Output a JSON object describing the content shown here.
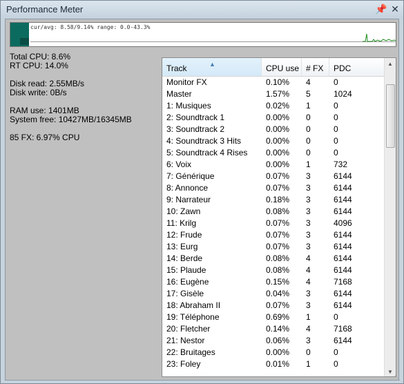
{
  "window": {
    "title": "Performance Meter"
  },
  "meter": {
    "readout": "cur/avg: 8.58/9.14%  range: 0.0-43.3%"
  },
  "stats": {
    "total_cpu": "Total CPU: 8.6%",
    "rt_cpu": "RT CPU: 14.0%",
    "disk_read": "Disk read: 2.55MB/s",
    "disk_write": "Disk write: 0B/s",
    "ram_use": "RAM use: 1401MB",
    "system_free": "System free: 10427MB/16345MB",
    "fx_summary": "85 FX: 6.97% CPU"
  },
  "table": {
    "headers": [
      "Track",
      "CPU use",
      "# FX",
      "PDC"
    ],
    "rows": [
      [
        "Monitor FX",
        "0.10%",
        "4",
        "0"
      ],
      [
        "Master",
        "1.57%",
        "5",
        "1024"
      ],
      [
        "1: Musiques",
        "0.02%",
        "1",
        "0"
      ],
      [
        "2: Soundtrack 1",
        "0.00%",
        "0",
        "0"
      ],
      [
        "3: Soundtrack 2",
        "0.00%",
        "0",
        "0"
      ],
      [
        "4: Soundtrack 3 Hits",
        "0.00%",
        "0",
        "0"
      ],
      [
        "5: Soundtrack 4 Rises",
        "0.00%",
        "0",
        "0"
      ],
      [
        "6: Voix",
        "0.00%",
        "1",
        "732"
      ],
      [
        "7: Générique",
        "0.07%",
        "3",
        "6144"
      ],
      [
        "8: Annonce",
        "0.07%",
        "3",
        "6144"
      ],
      [
        "9: Narrateur",
        "0.18%",
        "3",
        "6144"
      ],
      [
        "10: Zawn",
        "0.08%",
        "3",
        "6144"
      ],
      [
        "11: Krilg",
        "0.07%",
        "3",
        "4096"
      ],
      [
        "12: Frude",
        "0.07%",
        "3",
        "6144"
      ],
      [
        "13: Eurg",
        "0.07%",
        "3",
        "6144"
      ],
      [
        "14: Berde",
        "0.08%",
        "4",
        "6144"
      ],
      [
        "15: Plaude",
        "0.08%",
        "4",
        "6144"
      ],
      [
        "16: Eugène",
        "0.15%",
        "4",
        "7168"
      ],
      [
        "17: Gisèle",
        "0.04%",
        "3",
        "6144"
      ],
      [
        "18: Abraham II",
        "0.07%",
        "3",
        "6144"
      ],
      [
        "19: Téléphone",
        "0.69%",
        "1",
        "0"
      ],
      [
        "20: Fletcher",
        "0.14%",
        "4",
        "7168"
      ],
      [
        "21: Nestor",
        "0.06%",
        "3",
        "6144"
      ],
      [
        "22: Bruitages",
        "0.00%",
        "0",
        "0"
      ],
      [
        "23: Foley",
        "0.01%",
        "1",
        "0"
      ]
    ]
  },
  "icons": {
    "pin": "pin-icon",
    "close": "close-icon",
    "sort": "sort-ascending-icon"
  },
  "colors": {
    "meter_bar": "#0c6b5f",
    "meter_graph": "#1a8a1a"
  }
}
